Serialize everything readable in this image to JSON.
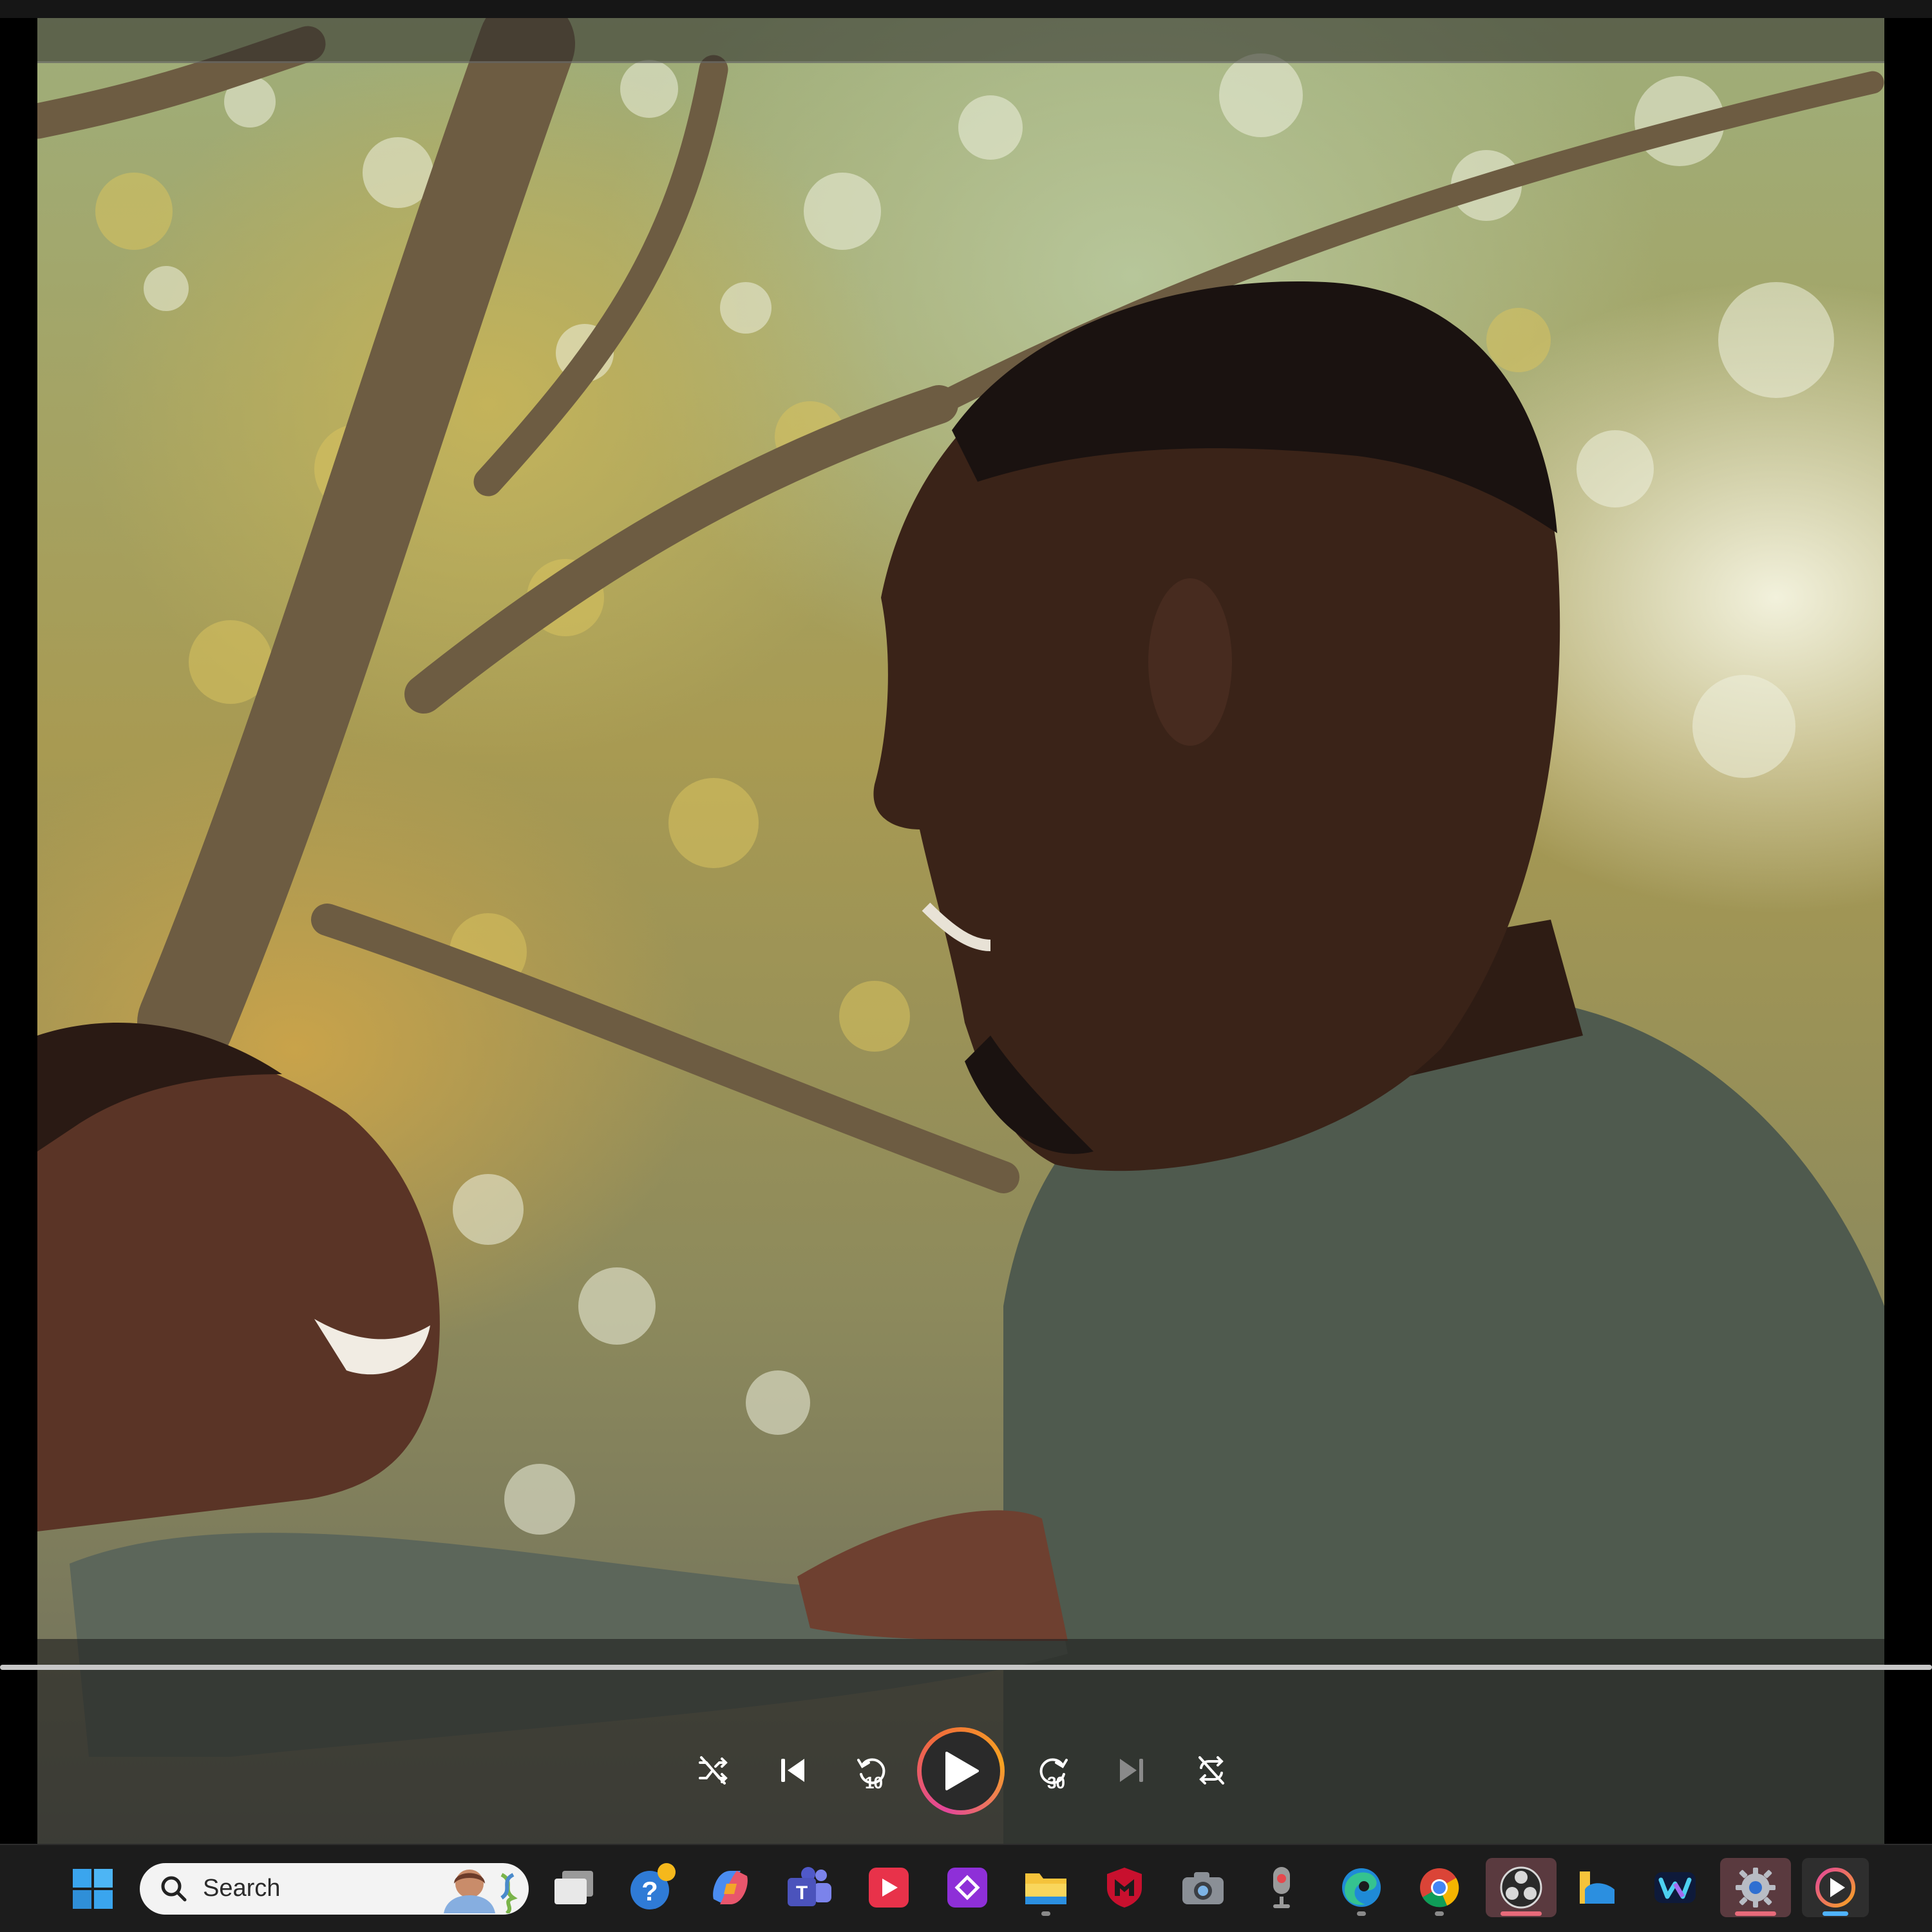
{
  "player": {
    "progress": 0.0,
    "controls": {
      "shuffle": "shuffle-icon",
      "previous": "previous-icon",
      "skip_back": "10",
      "play": "play-icon",
      "skip_forward": "30",
      "next": "next-icon",
      "repeat": "repeat-off-icon"
    },
    "colors": {
      "play_ring_start": "#e3469a",
      "play_ring_end": "#f7a321"
    }
  },
  "taskbar": {
    "search": {
      "placeholder": "Search"
    },
    "apps": [
      "start-icon",
      "task-view-icon",
      "get-help-icon",
      "copilot-icon",
      "teams-icon",
      "media-player-icon",
      "power-automate-icon",
      "file-explorer-icon",
      "mcafee-icon",
      "camera-icon",
      "voice-recorder-icon",
      "edge-icon",
      "chrome-icon",
      "obs-studio-icon",
      "file-share-icon",
      "clipchamp-icon",
      "settings-icon",
      "media-player-active-icon"
    ]
  }
}
